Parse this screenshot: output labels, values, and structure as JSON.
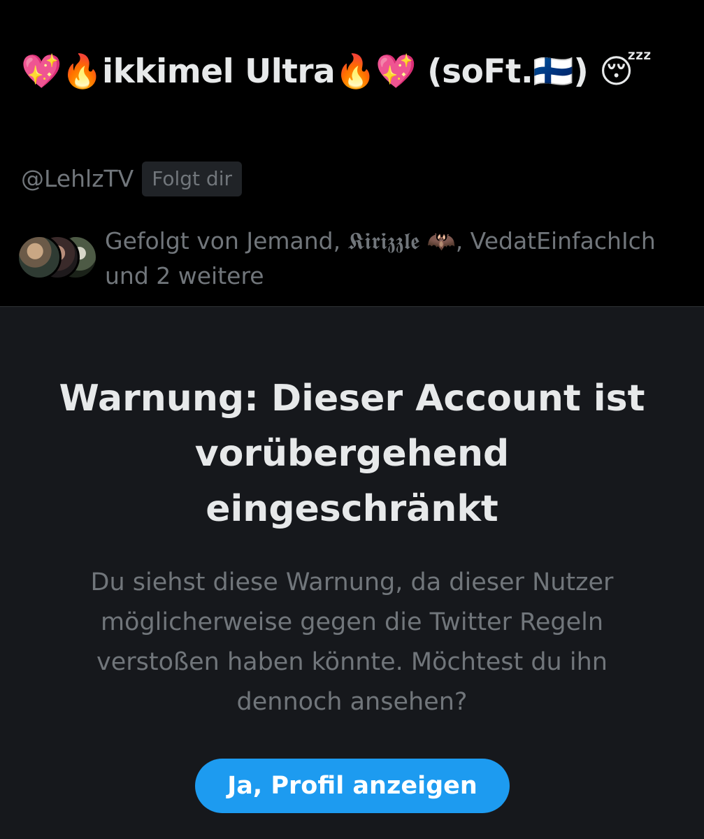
{
  "profile": {
    "display_name": "💖🔥ikkimel Ultra🔥💖 (soFt.🇫🇮) 😴",
    "handle": "@LehlzTV",
    "follows_you_badge": "Folgt dir",
    "followed_by_text": "Gefolgt von Jemand, 𝕶𝖎𝖗𝖎𝖟𝖟𝖑𝖊 🦇, VedatEinfachIch und 2 weitere"
  },
  "warning": {
    "title": "Warnung: Dieser Account ist vorübergehend eingeschränkt",
    "body": "Du siehst diese Warnung, da dieser Nutzer möglicherweise gegen die Twitter Regeln verstoßen haben könnte. Möchtest du ihn dennoch ansehen?",
    "button_label": "Ja, Profil anzeigen"
  },
  "colors": {
    "background": "#000000",
    "panel_background": "#16181c",
    "primary_text": "#e7e9ea",
    "secondary_text": "#71767b",
    "accent": "#1d9bf0"
  }
}
